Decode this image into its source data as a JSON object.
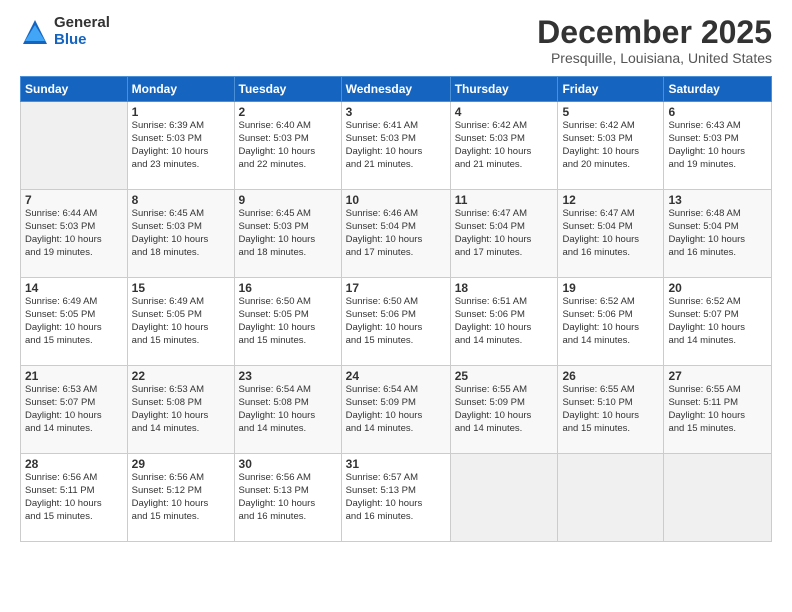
{
  "logo": {
    "general": "General",
    "blue": "Blue"
  },
  "header": {
    "month": "December 2025",
    "location": "Presquille, Louisiana, United States"
  },
  "weekdays": [
    "Sunday",
    "Monday",
    "Tuesday",
    "Wednesday",
    "Thursday",
    "Friday",
    "Saturday"
  ],
  "weeks": [
    [
      {
        "day": "",
        "sunrise": "",
        "sunset": "",
        "daylight": ""
      },
      {
        "day": "1",
        "sunrise": "Sunrise: 6:39 AM",
        "sunset": "Sunset: 5:03 PM",
        "daylight": "Daylight: 10 hours and 23 minutes."
      },
      {
        "day": "2",
        "sunrise": "Sunrise: 6:40 AM",
        "sunset": "Sunset: 5:03 PM",
        "daylight": "Daylight: 10 hours and 22 minutes."
      },
      {
        "day": "3",
        "sunrise": "Sunrise: 6:41 AM",
        "sunset": "Sunset: 5:03 PM",
        "daylight": "Daylight: 10 hours and 21 minutes."
      },
      {
        "day": "4",
        "sunrise": "Sunrise: 6:42 AM",
        "sunset": "Sunset: 5:03 PM",
        "daylight": "Daylight: 10 hours and 21 minutes."
      },
      {
        "day": "5",
        "sunrise": "Sunrise: 6:42 AM",
        "sunset": "Sunset: 5:03 PM",
        "daylight": "Daylight: 10 hours and 20 minutes."
      },
      {
        "day": "6",
        "sunrise": "Sunrise: 6:43 AM",
        "sunset": "Sunset: 5:03 PM",
        "daylight": "Daylight: 10 hours and 19 minutes."
      }
    ],
    [
      {
        "day": "7",
        "sunrise": "Sunrise: 6:44 AM",
        "sunset": "Sunset: 5:03 PM",
        "daylight": "Daylight: 10 hours and 19 minutes."
      },
      {
        "day": "8",
        "sunrise": "Sunrise: 6:45 AM",
        "sunset": "Sunset: 5:03 PM",
        "daylight": "Daylight: 10 hours and 18 minutes."
      },
      {
        "day": "9",
        "sunrise": "Sunrise: 6:45 AM",
        "sunset": "Sunset: 5:03 PM",
        "daylight": "Daylight: 10 hours and 18 minutes."
      },
      {
        "day": "10",
        "sunrise": "Sunrise: 6:46 AM",
        "sunset": "Sunset: 5:04 PM",
        "daylight": "Daylight: 10 hours and 17 minutes."
      },
      {
        "day": "11",
        "sunrise": "Sunrise: 6:47 AM",
        "sunset": "Sunset: 5:04 PM",
        "daylight": "Daylight: 10 hours and 17 minutes."
      },
      {
        "day": "12",
        "sunrise": "Sunrise: 6:47 AM",
        "sunset": "Sunset: 5:04 PM",
        "daylight": "Daylight: 10 hours and 16 minutes."
      },
      {
        "day": "13",
        "sunrise": "Sunrise: 6:48 AM",
        "sunset": "Sunset: 5:04 PM",
        "daylight": "Daylight: 10 hours and 16 minutes."
      }
    ],
    [
      {
        "day": "14",
        "sunrise": "Sunrise: 6:49 AM",
        "sunset": "Sunset: 5:05 PM",
        "daylight": "Daylight: 10 hours and 15 minutes."
      },
      {
        "day": "15",
        "sunrise": "Sunrise: 6:49 AM",
        "sunset": "Sunset: 5:05 PM",
        "daylight": "Daylight: 10 hours and 15 minutes."
      },
      {
        "day": "16",
        "sunrise": "Sunrise: 6:50 AM",
        "sunset": "Sunset: 5:05 PM",
        "daylight": "Daylight: 10 hours and 15 minutes."
      },
      {
        "day": "17",
        "sunrise": "Sunrise: 6:50 AM",
        "sunset": "Sunset: 5:06 PM",
        "daylight": "Daylight: 10 hours and 15 minutes."
      },
      {
        "day": "18",
        "sunrise": "Sunrise: 6:51 AM",
        "sunset": "Sunset: 5:06 PM",
        "daylight": "Daylight: 10 hours and 14 minutes."
      },
      {
        "day": "19",
        "sunrise": "Sunrise: 6:52 AM",
        "sunset": "Sunset: 5:06 PM",
        "daylight": "Daylight: 10 hours and 14 minutes."
      },
      {
        "day": "20",
        "sunrise": "Sunrise: 6:52 AM",
        "sunset": "Sunset: 5:07 PM",
        "daylight": "Daylight: 10 hours and 14 minutes."
      }
    ],
    [
      {
        "day": "21",
        "sunrise": "Sunrise: 6:53 AM",
        "sunset": "Sunset: 5:07 PM",
        "daylight": "Daylight: 10 hours and 14 minutes."
      },
      {
        "day": "22",
        "sunrise": "Sunrise: 6:53 AM",
        "sunset": "Sunset: 5:08 PM",
        "daylight": "Daylight: 10 hours and 14 minutes."
      },
      {
        "day": "23",
        "sunrise": "Sunrise: 6:54 AM",
        "sunset": "Sunset: 5:08 PM",
        "daylight": "Daylight: 10 hours and 14 minutes."
      },
      {
        "day": "24",
        "sunrise": "Sunrise: 6:54 AM",
        "sunset": "Sunset: 5:09 PM",
        "daylight": "Daylight: 10 hours and 14 minutes."
      },
      {
        "day": "25",
        "sunrise": "Sunrise: 6:55 AM",
        "sunset": "Sunset: 5:09 PM",
        "daylight": "Daylight: 10 hours and 14 minutes."
      },
      {
        "day": "26",
        "sunrise": "Sunrise: 6:55 AM",
        "sunset": "Sunset: 5:10 PM",
        "daylight": "Daylight: 10 hours and 15 minutes."
      },
      {
        "day": "27",
        "sunrise": "Sunrise: 6:55 AM",
        "sunset": "Sunset: 5:11 PM",
        "daylight": "Daylight: 10 hours and 15 minutes."
      }
    ],
    [
      {
        "day": "28",
        "sunrise": "Sunrise: 6:56 AM",
        "sunset": "Sunset: 5:11 PM",
        "daylight": "Daylight: 10 hours and 15 minutes."
      },
      {
        "day": "29",
        "sunrise": "Sunrise: 6:56 AM",
        "sunset": "Sunset: 5:12 PM",
        "daylight": "Daylight: 10 hours and 15 minutes."
      },
      {
        "day": "30",
        "sunrise": "Sunrise: 6:56 AM",
        "sunset": "Sunset: 5:13 PM",
        "daylight": "Daylight: 10 hours and 16 minutes."
      },
      {
        "day": "31",
        "sunrise": "Sunrise: 6:57 AM",
        "sunset": "Sunset: 5:13 PM",
        "daylight": "Daylight: 10 hours and 16 minutes."
      },
      {
        "day": "",
        "sunrise": "",
        "sunset": "",
        "daylight": ""
      },
      {
        "day": "",
        "sunrise": "",
        "sunset": "",
        "daylight": ""
      },
      {
        "day": "",
        "sunrise": "",
        "sunset": "",
        "daylight": ""
      }
    ]
  ]
}
